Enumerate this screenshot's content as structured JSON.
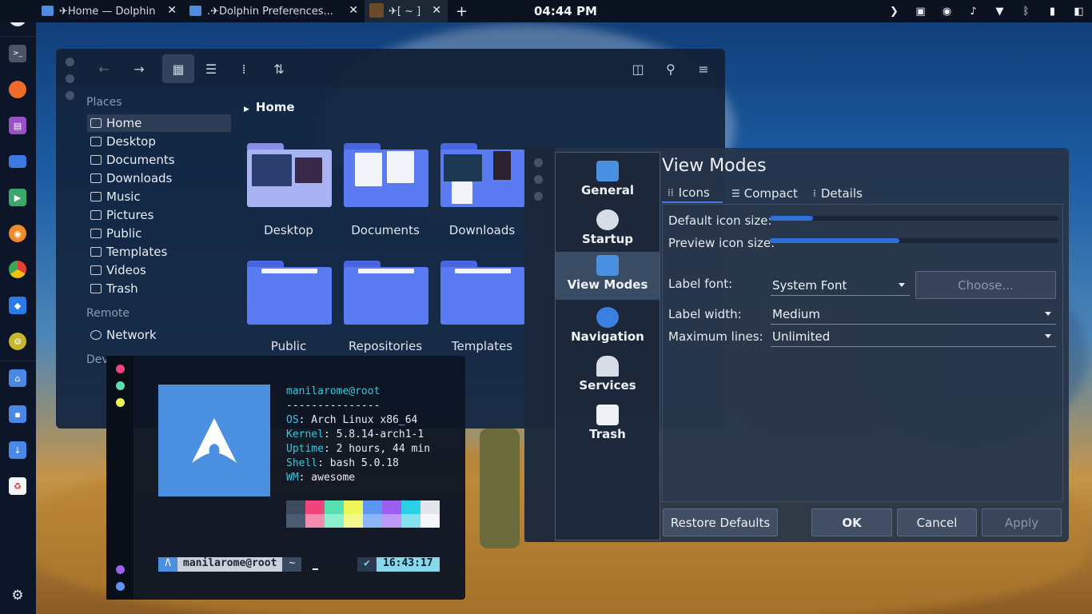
{
  "topbar": {
    "tabs": [
      {
        "label": "✈Home — Dolphin",
        "close": "✕"
      },
      {
        "label": ".✈Dolphin Preferences...",
        "close": "✕"
      },
      {
        "label": "✈[ ~ ]",
        "close": "✕"
      }
    ],
    "new_tab": "+",
    "clock": "04:44 PM"
  },
  "dock": {
    "apps": [
      "telegram-icon",
      "terminal-icon",
      "firefox-icon",
      "app-icon",
      "files-icon",
      "player-icon",
      "game-icon",
      "chrome-icon",
      "cube-icon",
      "network-tool-icon",
      "home-folder-icon",
      "docs-folder-icon",
      "downloads-folder-icon",
      "trash-icon"
    ],
    "colors": {
      "bg": "#0c1628"
    }
  },
  "dolphin": {
    "places_heading": "Places",
    "places": [
      {
        "label": "Home",
        "selected": true
      },
      {
        "label": "Desktop"
      },
      {
        "label": "Documents"
      },
      {
        "label": "Downloads"
      },
      {
        "label": "Music"
      },
      {
        "label": "Pictures"
      },
      {
        "label": "Public"
      },
      {
        "label": "Templates"
      },
      {
        "label": "Videos"
      },
      {
        "label": "Trash"
      }
    ],
    "remote_heading": "Remote",
    "remote": [
      {
        "label": "Network"
      }
    ],
    "devices_heading": "Dev",
    "breadcrumb": "Home",
    "folders": [
      "Desktop",
      "Documents",
      "Downloads",
      "Public",
      "Repositories",
      "Templates"
    ]
  },
  "terminal": {
    "user_host": "manilarome@root",
    "separator": "---------------",
    "info": [
      {
        "key": "OS",
        "value": ": Arch Linux x86_64"
      },
      {
        "key": "Kernel",
        "value": ": 5.8.14-arch1-1"
      },
      {
        "key": "Uptime",
        "value": ": 2 hours, 44 min"
      },
      {
        "key": "Shell",
        "value": ": bash 5.0.18"
      },
      {
        "key": "WM",
        "value": ": awesome"
      }
    ],
    "palette_top": [
      "#3c4b60",
      "#f0457e",
      "#56e0b0",
      "#eef65a",
      "#5b96f2",
      "#9b5ff2",
      "#2bd0e6",
      "#e2e6ec"
    ],
    "palette_bottom": [
      "#4a5a70",
      "#f48cb0",
      "#8df0cc",
      "#f2f88c",
      "#8cb6f8",
      "#be98f8",
      "#84e2ef",
      "#f4f6f8"
    ],
    "prompt_arch": "Λ",
    "prompt_user": "manilarome@root",
    "prompt_dir": "~",
    "check": "✔",
    "time": "16:43:17"
  },
  "prefs": {
    "categories": [
      "General",
      "Startup",
      "View Modes",
      "Navigation",
      "Services",
      "Trash"
    ],
    "title": "View Modes",
    "tabs": [
      "Icons",
      "Compact",
      "Details"
    ],
    "default_icon_size_label": "Default icon size:",
    "default_icon_size": 0.15,
    "preview_icon_size_label": "Preview icon size:",
    "preview_icon_size": 0.45,
    "label_font_label": "Label font:",
    "label_font": "System Font",
    "choose": "Choose...",
    "label_width_label": "Label width:",
    "label_width": "Medium",
    "max_lines_label": "Maximum lines:",
    "max_lines": "Unlimited",
    "buttons": {
      "restore": "Restore Defaults",
      "ok": "OK",
      "cancel": "Cancel",
      "apply": "Apply"
    }
  }
}
